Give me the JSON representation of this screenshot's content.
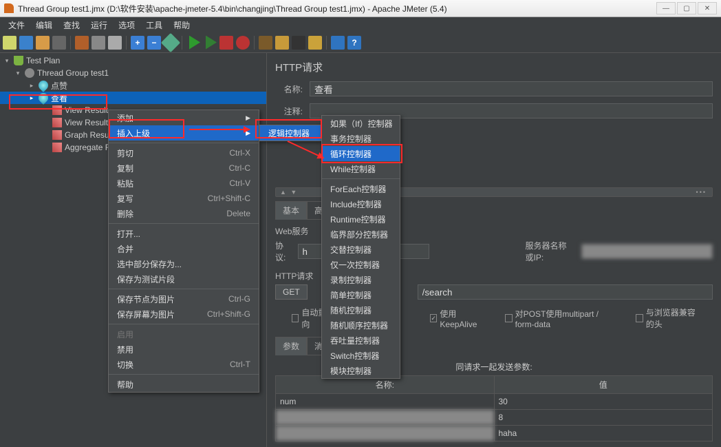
{
  "window": {
    "title": "Thread Group test1.jmx (D:\\软件安装\\apache-jmeter-5.4\\bin\\changjing\\Thread Group test1.jmx) - Apache JMeter (5.4)"
  },
  "menubar": [
    "文件",
    "编辑",
    "查找",
    "运行",
    "选项",
    "工具",
    "帮助"
  ],
  "tree": {
    "root": "Test Plan",
    "thread_group": "Thread Group test1",
    "node_like": "点赞",
    "node_view_selected": "查看",
    "children": [
      "View Result",
      "View Result",
      "Graph Result",
      "Aggregate R"
    ]
  },
  "content": {
    "title": "HTTP请求",
    "name_label": "名称:",
    "name_value": "查看",
    "comment_label": "注释:",
    "tabs": {
      "basic": "基本",
      "advanced": "高级"
    },
    "web_section": "Web服务",
    "protocol_label": "协议:",
    "protocol_value": "h",
    "server_label": "服务器名称或IP:",
    "server_value": "",
    "http_label": "HTTP请求",
    "method": "GET",
    "path": "/search",
    "auto_redirect": "自动重定向",
    "keepalive": "使用 KeepAlive",
    "multipart": "对POST使用multipart / form-data",
    "browser_header": "与浏览器兼容的头",
    "param_tab": "参数",
    "msg_tab": "消息",
    "params_title": "同请求一起发送参数:",
    "col_name": "名称:",
    "col_value": "值",
    "rows": [
      {
        "name": "num",
        "value": "30"
      },
      {
        "name": "",
        "value": "8"
      },
      {
        "name": "",
        "value": "haha"
      }
    ]
  },
  "context_menu": {
    "add": "添加",
    "insert_parent": "插入上级",
    "cut": "剪切",
    "cut_sc": "Ctrl-X",
    "copy": "复制",
    "copy_sc": "Ctrl-C",
    "paste": "粘贴",
    "paste_sc": "Ctrl-V",
    "duplicate": "复写",
    "duplicate_sc": "Ctrl+Shift-C",
    "delete": "删除",
    "delete_sc": "Delete",
    "open": "打开...",
    "merge": "合并",
    "save_sel": "选中部分保存为...",
    "save_fragment": "保存为测试片段",
    "save_node_img": "保存节点为图片",
    "save_node_img_sc": "Ctrl-G",
    "save_screen_img": "保存屏幕为图片",
    "save_screen_img_sc": "Ctrl+Shift-G",
    "enable": "启用",
    "disable": "禁用",
    "toggle": "切换",
    "toggle_sc": "Ctrl-T",
    "help": "帮助"
  },
  "submenu1": {
    "logic": "逻辑控制器"
  },
  "submenu2": {
    "items": [
      "如果（If）控制器",
      "事务控制器",
      "循环控制器",
      "While控制器",
      "ForEach控制器",
      "Include控制器",
      "Runtime控制器",
      "临界部分控制器",
      "交替控制器",
      "仅一次控制器",
      "录制控制器",
      "简单控制器",
      "随机控制器",
      "随机顺序控制器",
      "吞吐量控制器",
      "Switch控制器",
      "模块控制器"
    ],
    "selected_index": 2
  }
}
